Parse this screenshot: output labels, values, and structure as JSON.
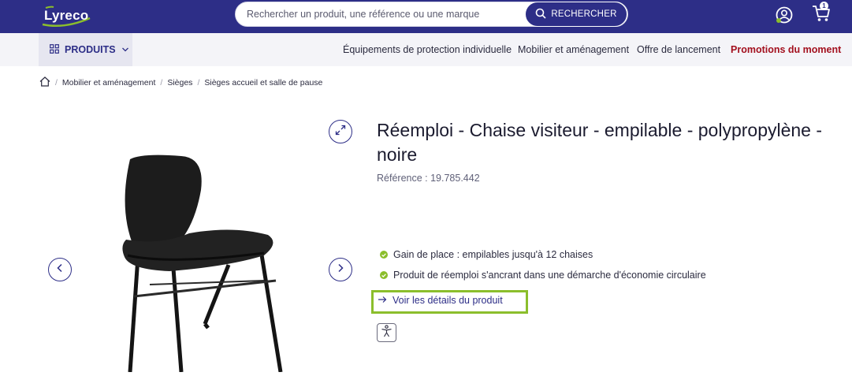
{
  "header": {
    "logo_text": "Lyreco",
    "search": {
      "placeholder": "Rechercher un produit, une référence ou une marque",
      "button_label": "RECHERCHER"
    },
    "cart_count": "1",
    "icons": [
      "lyreco-logo",
      "search-icon",
      "account-icon",
      "cart-icon"
    ]
  },
  "nav": {
    "products_label": "PRODUITS",
    "links": [
      "Équipements de protection individuelle",
      "Mobilier et aménagement",
      "Offre de lancement",
      "Promotions du moment"
    ],
    "promo_color": "#a3101e"
  },
  "breadcrumb": [
    "Mobilier et aménagement",
    "Sièges",
    "Sièges accueil et salle de pause"
  ],
  "product": {
    "title": "Réemploi - Chaise visiteur - empilable - polypropylène - noire",
    "reference": "Référence : 19.785.442",
    "bullets": [
      "Gain de place : empilables jusqu'à 12 chaises",
      "Produit de réemploi s'ancrant dans une démarche d'économie circulaire"
    ],
    "details_link": "Voir les détails du produit"
  },
  "colors": {
    "brand": "#2d2e87",
    "accent_green": "#8bbe2c"
  }
}
